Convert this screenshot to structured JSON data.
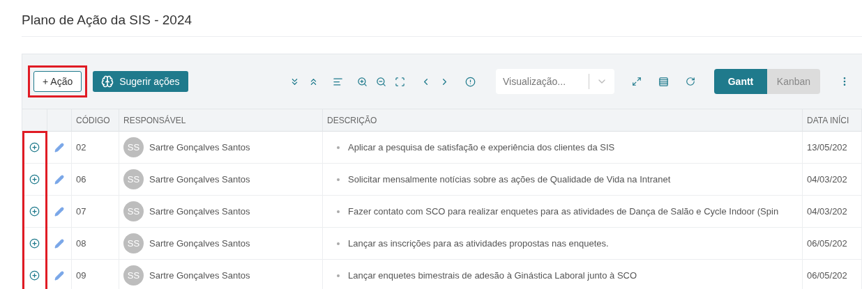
{
  "page": {
    "title": "Plano de Ação da SIS - 2024"
  },
  "toolbar": {
    "add_button": "+ Ação",
    "suggest_button": "Sugerir ações",
    "view_select": {
      "placeholder": "Visualização..."
    },
    "view_tabs": [
      {
        "label": "Gantt",
        "selected": true
      },
      {
        "label": "Kanban",
        "selected": false
      }
    ]
  },
  "highlights": {
    "add_button": true,
    "add_column": true
  },
  "table": {
    "columns": [
      "CÓDIGO",
      "RESPONSÁVEL",
      "DESCRIÇÃO",
      "DATA INÍCI"
    ],
    "rows": [
      {
        "code": "02",
        "initials": "SS",
        "responsible": "Sartre Gonçalves Santos",
        "description": "Aplicar a pesquisa de satisfação e experiência dos clientes da SIS",
        "start_date": "13/05/202"
      },
      {
        "code": "06",
        "initials": "SS",
        "responsible": "Sartre Gonçalves Santos",
        "description": "Solicitar mensalmente notícias sobre as ações de Qualidade de Vida na Intranet",
        "start_date": "04/03/202"
      },
      {
        "code": "07",
        "initials": "SS",
        "responsible": "Sartre Gonçalves Santos",
        "description": "Fazer contato com SCO para realizar enquetes para as atividades de Dança de Salão e Cycle Indoor (Spin",
        "start_date": "04/03/202"
      },
      {
        "code": "08",
        "initials": "SS",
        "responsible": "Sartre Gonçalves Santos",
        "description": "Lançar as inscrições para as atividades propostas nas enquetes.",
        "start_date": "06/05/202"
      },
      {
        "code": "09",
        "initials": "SS",
        "responsible": "Sartre Gonçalves Santos",
        "description": "Lançar enquetes bimestrais de adesão à Ginástica Laboral junto à SCO",
        "start_date": "06/05/202"
      }
    ]
  }
}
